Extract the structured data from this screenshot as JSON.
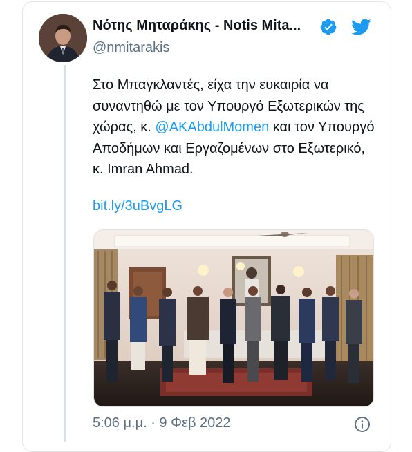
{
  "tweet": {
    "display_name": "Νότης Μηταράκης - Notis Mita...",
    "handle": "@nmitarakis",
    "text_before": "Στο Μπαγκλαντές, είχα την ευκαιρία να συναντηθώ με τον Υπουργό Εξωτερικών της χώρας, κ. ",
    "mention": "@AKAbdulMomen",
    "text_after": " και τον Υπουργό Αποδήμων και Εργαζομένων στο Εξωτερικό, κ. Imran Ahmad.",
    "link": "bit.ly/3uBvgLG",
    "timestamp": "5:06 μ.μ. · 9 Φεβ 2022"
  },
  "colors": {
    "accent": "#1d9bf0",
    "secondary_text": "#5b7083",
    "primary_text": "#0f1419"
  },
  "icons": {
    "verified": "verified-badge-icon",
    "twitter": "twitter-bird-icon",
    "info": "info-icon"
  }
}
